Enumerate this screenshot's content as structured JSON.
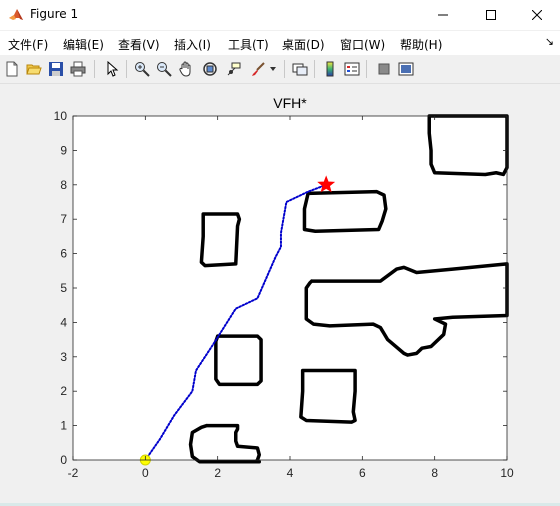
{
  "window": {
    "title": "Figure 1",
    "controls": [
      "minimize",
      "maximize",
      "close"
    ]
  },
  "menu": [
    {
      "label": "文件(F)"
    },
    {
      "label": "编辑(E)"
    },
    {
      "label": "查看(V)"
    },
    {
      "label": "插入(I)"
    },
    {
      "label": "工具(T)"
    },
    {
      "label": "桌面(D)"
    },
    {
      "label": "窗口(W)"
    },
    {
      "label": "帮助(H)"
    }
  ],
  "toolbar": {
    "buttons": [
      "new-figure-icon",
      "open-file-icon",
      "save-icon",
      "print-icon",
      "edit-plot-arrow-icon",
      "zoom-in-icon",
      "zoom-out-icon",
      "pan-hand-icon",
      "rotate-3d-icon",
      "data-cursor-icon",
      "brush-icon",
      "dropdown-arrow-icon",
      "link-plot-icon",
      "insert-colorbar-icon",
      "insert-legend-icon",
      "hide-plot-tools-icon",
      "show-plot-tools-icon"
    ]
  },
  "chart_data": {
    "type": "line",
    "title": "VFH*",
    "xlabel": "",
    "ylabel": "",
    "xlim": [
      -2,
      10
    ],
    "ylim": [
      0,
      10
    ],
    "xticks": [
      "-2",
      "0",
      "2",
      "4",
      "6",
      "8",
      "10"
    ],
    "yticks": [
      "0",
      "1",
      "2",
      "3",
      "4",
      "5",
      "6",
      "7",
      "8",
      "9",
      "10"
    ],
    "grid": false,
    "path": {
      "color": "#0000cc",
      "style": "dotted",
      "x": [
        0,
        0.4,
        0.8,
        1.3,
        1.4,
        1.9,
        2.5,
        3.1,
        3.6,
        3.75,
        3.75,
        3.9,
        4.5,
        5.0
      ],
      "y": [
        0,
        0.6,
        1.3,
        2.0,
        2.6,
        3.4,
        4.4,
        4.7,
        5.9,
        6.2,
        6.6,
        7.5,
        7.8,
        8.0
      ]
    },
    "start": {
      "x": 0,
      "y": 0,
      "color": "#ffff00",
      "marker": "circle"
    },
    "goal": {
      "x": 5.0,
      "y": 8.0,
      "color": "#ff0000",
      "marker": "star"
    },
    "obstacles": [
      {
        "color": "#000000",
        "x": [
          1.7,
          2.55,
          2.55,
          2.5,
          2.5,
          2.55,
          3.1,
          3.15,
          3.1,
          3.05,
          3.15,
          2.9,
          1.5,
          1.3,
          1.25,
          1.3,
          1.55,
          1.7
        ],
        "y": [
          1.0,
          1.0,
          0.9,
          0.8,
          0.55,
          0.4,
          0.35,
          0.15,
          0.0,
          -0.05,
          -0.05,
          -0.05,
          -0.05,
          0.1,
          0.45,
          0.8,
          0.95,
          1.0
        ]
      },
      {
        "color": "#000000",
        "x": [
          2.0,
          3.1,
          3.2,
          3.2,
          3.1,
          2.05,
          1.95,
          1.95,
          2.0
        ],
        "y": [
          3.6,
          3.6,
          3.5,
          2.3,
          2.2,
          2.2,
          2.35,
          3.45,
          3.6
        ]
      },
      {
        "color": "#000000",
        "x": [
          1.6,
          2.55,
          2.6,
          2.55,
          2.5,
          1.65,
          1.55,
          1.6,
          1.6
        ],
        "y": [
          7.15,
          7.15,
          7.0,
          6.8,
          5.7,
          5.65,
          5.75,
          6.5,
          7.15
        ]
      },
      {
        "color": "#000000",
        "x": [
          4.35,
          5.8,
          5.8,
          5.75,
          5.8,
          5.7,
          4.45,
          4.3,
          4.35,
          4.35
        ],
        "y": [
          2.6,
          2.6,
          2.0,
          1.4,
          1.15,
          1.1,
          1.15,
          1.25,
          2.0,
          2.6
        ]
      },
      {
        "color": "#000000",
        "x": [
          4.5,
          6.4,
          6.6,
          6.65,
          6.55,
          6.45,
          4.7,
          4.4,
          4.4,
          4.5
        ],
        "y": [
          7.75,
          7.8,
          7.7,
          7.3,
          6.95,
          6.7,
          6.65,
          6.7,
          7.3,
          7.75
        ]
      },
      {
        "color": "#000000",
        "x": [
          4.6,
          6.1,
          6.5,
          6.95,
          7.15,
          7.5,
          8.5,
          9.0,
          10.0,
          10.0,
          8.5,
          8.0,
          8.3,
          8.25,
          7.9,
          7.65,
          7.5,
          7.25,
          7.15,
          6.7,
          6.5,
          6.3,
          5.1,
          4.65,
          4.45,
          4.45,
          4.55,
          4.6
        ],
        "y": [
          5.2,
          5.2,
          5.2,
          5.55,
          5.6,
          5.45,
          5.55,
          5.6,
          5.7,
          4.2,
          4.15,
          4.1,
          3.95,
          3.65,
          3.3,
          3.25,
          3.1,
          3.05,
          3.1,
          3.5,
          3.85,
          3.95,
          3.9,
          3.95,
          4.1,
          5.0,
          5.15,
          5.2
        ]
      },
      {
        "color": "#000000",
        "x": [
          7.85,
          10.0,
          10.0,
          9.9,
          9.7,
          9.4,
          8.0,
          7.9,
          7.9,
          7.85,
          7.85
        ],
        "y": [
          10.0,
          10.0,
          8.5,
          8.3,
          8.35,
          8.3,
          8.35,
          8.6,
          9.0,
          9.5,
          10.0
        ]
      }
    ]
  }
}
